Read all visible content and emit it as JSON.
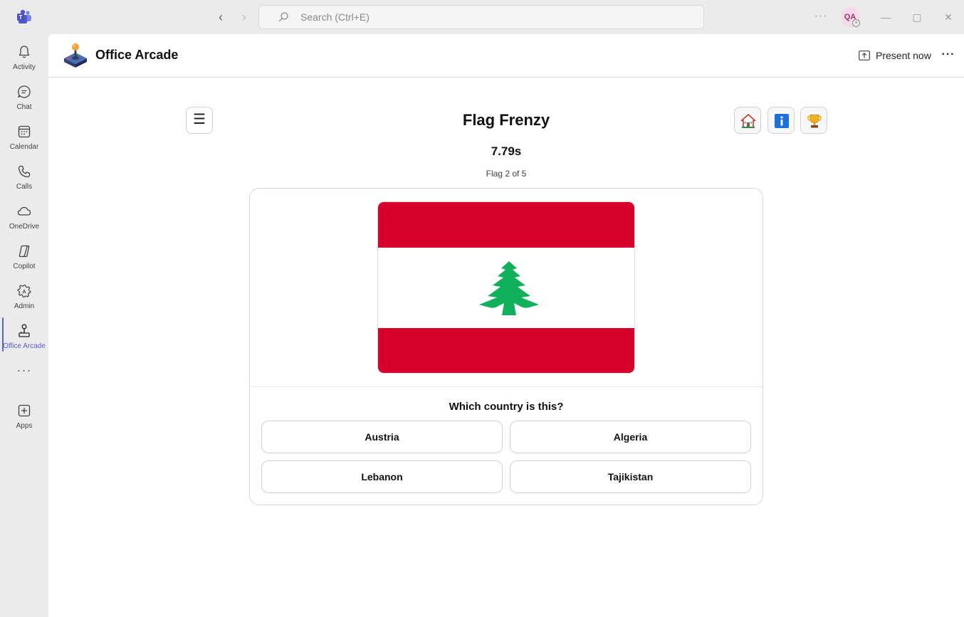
{
  "titlebar": {
    "search_placeholder": "Search (Ctrl+E)",
    "back_glyph": "‹",
    "forward_glyph": "›",
    "more_glyph": "···",
    "avatar_initials": "QA",
    "status_glyph": "×",
    "minimize_glyph": "—",
    "maximize_glyph": "▢",
    "close_glyph": "✕"
  },
  "rail": {
    "items": [
      {
        "label": "Activity",
        "icon": "bell-icon"
      },
      {
        "label": "Chat",
        "icon": "chat-icon"
      },
      {
        "label": "Calendar",
        "icon": "calendar-icon"
      },
      {
        "label": "Calls",
        "icon": "phone-icon"
      },
      {
        "label": "OneDrive",
        "icon": "cloud-icon"
      },
      {
        "label": "Copilot",
        "icon": "copilot-icon"
      },
      {
        "label": "Admin",
        "icon": "admin-gear-icon"
      },
      {
        "label": "Office Arcade",
        "icon": "joystick-icon",
        "active": true
      },
      {
        "label": "Apps",
        "icon": "add-apps-icon"
      }
    ],
    "more_glyph": "···"
  },
  "header": {
    "app_title": "Office Arcade",
    "present_label": "Present now",
    "more_glyph": "···"
  },
  "game": {
    "menu_glyph": "☰",
    "title": "Flag Frenzy",
    "timer": "7.79s",
    "progress": "Flag 2 of 5",
    "question": "Which country is this?",
    "answers": [
      "Austria",
      "Algeria",
      "Lebanon",
      "Tajikistan"
    ],
    "flag": "lebanon-flag",
    "top_buttons": [
      "home-icon",
      "info-icon",
      "trophy-icon"
    ]
  },
  "colors": {
    "accent": "#5b5fc7",
    "flag_red": "#d7002a",
    "flag_green": "#10b05c",
    "flag_white": "#ffffff"
  }
}
